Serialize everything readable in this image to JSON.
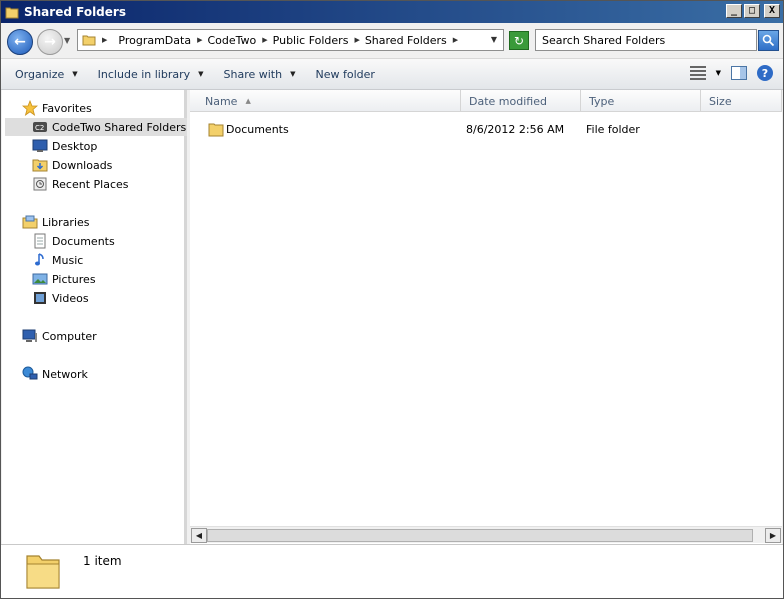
{
  "window": {
    "title": "Shared Folders",
    "controls": {
      "minimize": "_",
      "maximize": "□",
      "close": "X"
    }
  },
  "address_bar": {
    "crumbs": [
      "ProgramData",
      "CodeTwo",
      "Public Folders",
      "Shared Folders"
    ]
  },
  "search": {
    "placeholder": "Search Shared Folders"
  },
  "toolbar": {
    "organize": "Organize",
    "include_in_library": "Include in library",
    "share_with": "Share with",
    "new_folder": "New folder"
  },
  "nav_pane": {
    "favorites": "Favorites",
    "favorites_items": [
      "CodeTwo Shared Folders",
      "Desktop",
      "Downloads",
      "Recent Places"
    ],
    "libraries": "Libraries",
    "libraries_items": [
      "Documents",
      "Music",
      "Pictures",
      "Videos"
    ],
    "computer": "Computer",
    "network": "Network"
  },
  "columns": {
    "name": "Name",
    "date_modified": "Date modified",
    "type": "Type",
    "size": "Size"
  },
  "files": [
    {
      "name": "Documents",
      "date_modified": "8/6/2012 2:56 AM",
      "type": "File folder",
      "size": ""
    }
  ],
  "details": {
    "count": "1 item"
  },
  "colors": {
    "titlebar": "#0a246a",
    "accent": "#1e395b",
    "folder": "#e8c25a"
  }
}
